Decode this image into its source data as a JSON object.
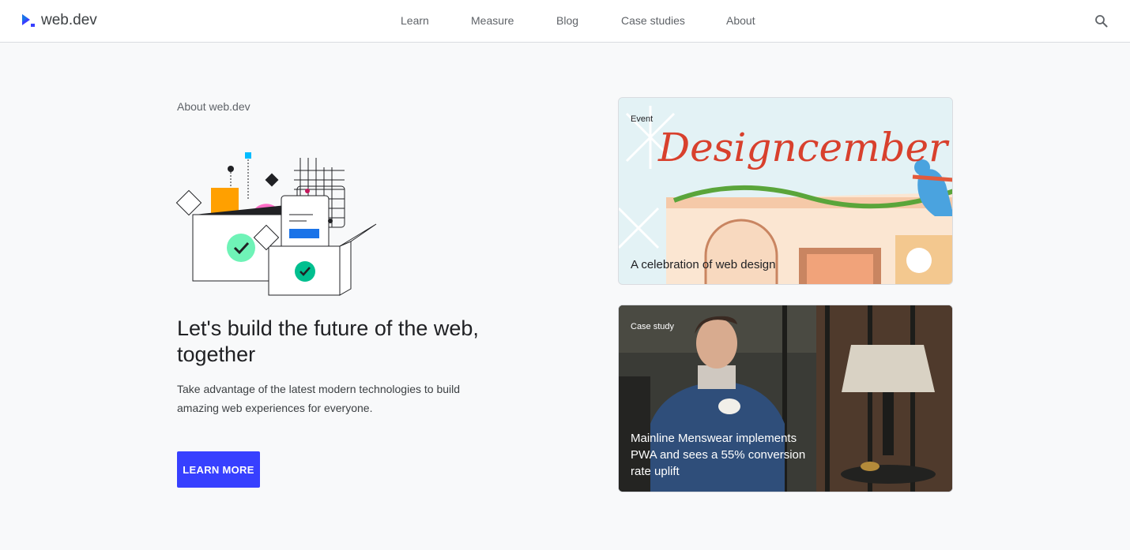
{
  "header": {
    "logo_text": "web.dev",
    "nav": [
      {
        "label": "Learn"
      },
      {
        "label": "Measure"
      },
      {
        "label": "Blog"
      },
      {
        "label": "Case studies"
      },
      {
        "label": "About"
      }
    ],
    "search_icon": "search-icon"
  },
  "hero": {
    "eyebrow": "About web.dev",
    "headline": "Let's build the future of the web, together",
    "description": "Take advantage of the latest modern technologies to build amazing web experiences for everyone.",
    "cta_label": "LEARN MORE"
  },
  "cards": [
    {
      "tag": "Event",
      "title": "A celebration of web design",
      "art_text": "Designcember"
    },
    {
      "tag": "Case study",
      "title": "Mainline Menswear implements PWA and sees a 55% conversion rate uplift"
    }
  ],
  "colors": {
    "brand_blue": "#3740ff",
    "page_bg": "#f8f9fa",
    "text_primary": "#202124",
    "text_secondary": "#5f6368"
  }
}
